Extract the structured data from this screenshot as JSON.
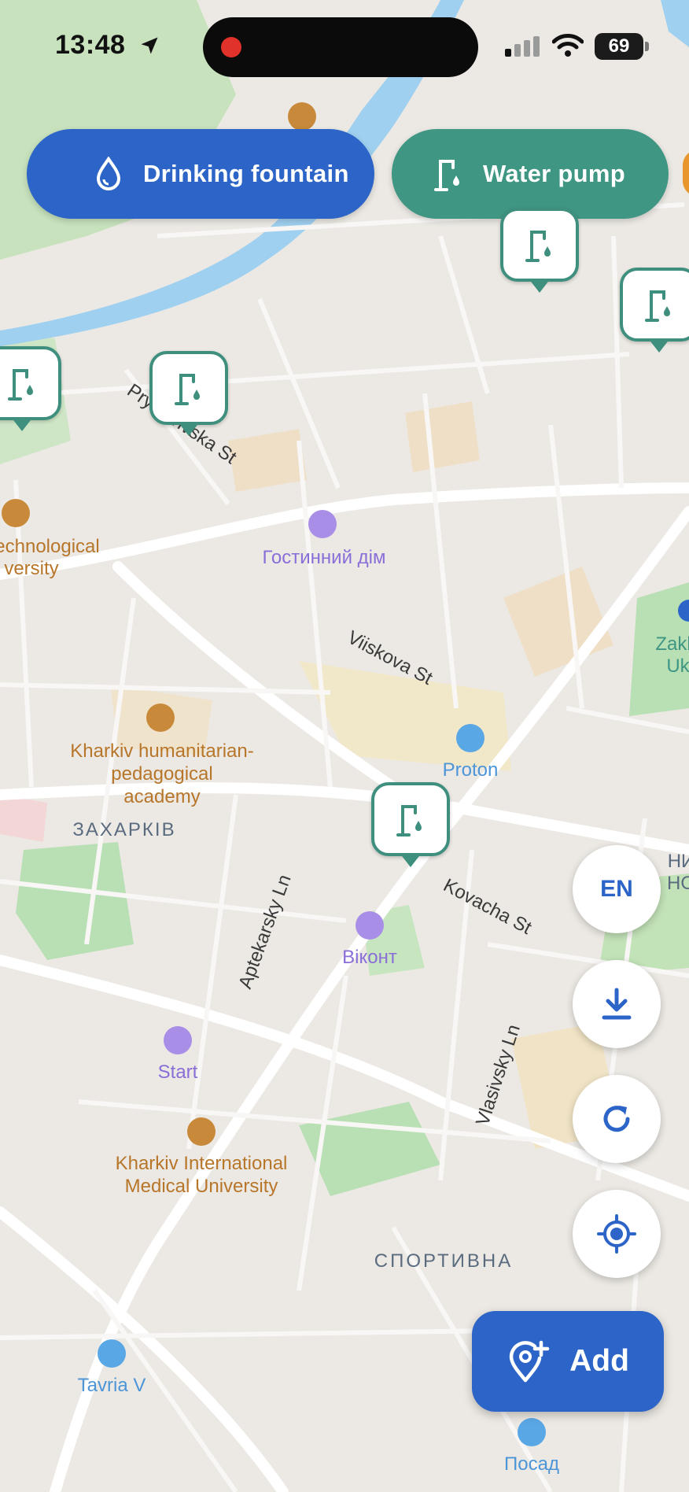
{
  "status_bar": {
    "time": "13:48",
    "battery": "69"
  },
  "filters": {
    "drinking_fountain": "Drinking fountain",
    "water_pump": "Water pump"
  },
  "map_labels": {
    "streets": [
      "Prymerivska St",
      "Viiskova St",
      "Kovacha St",
      "Aptekarsky Ln",
      "Vlasivsky Ln"
    ],
    "places": {
      "technological_line1": "echnological",
      "technological_line2": "versity",
      "hostynnyi_dim": "Гостинний дім",
      "humanitarian_line1": "Kharkiv humanitarian-",
      "humanitarian_line2": "pedagogical",
      "humanitarian_line3": "academy",
      "proton": "Proton",
      "zakharkiv": "ЗАХАРКІВ",
      "vikont": "Віконт",
      "start": "Start",
      "medical_line1": "Kharkiv International",
      "medical_line2": "Medical University",
      "sportyvna": "СПОРТИВНА",
      "tavria": "Tavria V",
      "posad": "Посад",
      "zakhv_line1": "Zakhy",
      "zakhv_line2": "Ukr",
      "edge_line1": "НИ",
      "edge_line2": "НО"
    }
  },
  "controls": {
    "language": "EN",
    "download_icon": "download-icon",
    "refresh_icon": "refresh-icon",
    "locate_icon": "crosshair-icon",
    "add_label": "Add"
  },
  "colors": {
    "fountain_blue": "#2c64c8",
    "pump_green": "#3f9683",
    "map_bg": "#ece9e4",
    "river": "#9fd0f0",
    "park": "#b9dfb4"
  }
}
